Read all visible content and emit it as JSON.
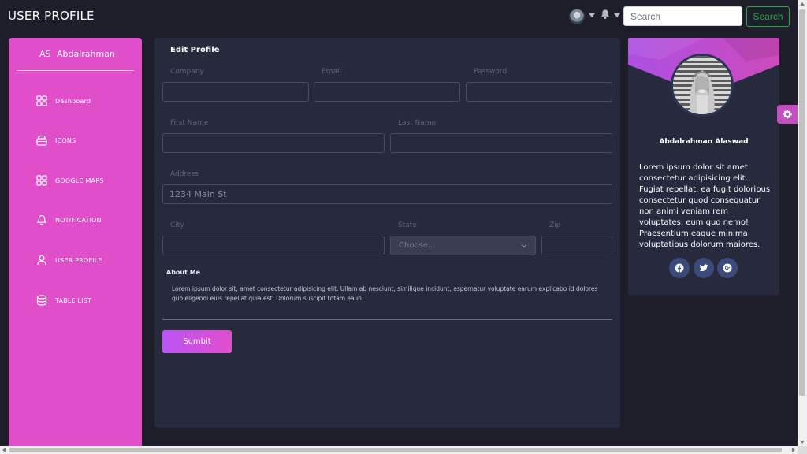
{
  "header": {
    "title": "USER PROFILE",
    "search_placeholder": "Search",
    "search_button": "Search"
  },
  "sidebar": {
    "user_initials": "AS",
    "user_name": "Abdalrahman",
    "items": [
      {
        "label": "Dashboard",
        "icon": "grid-icon"
      },
      {
        "label": "ICONS",
        "icon": "atom-icon"
      },
      {
        "label": "GOOGLE MAPS",
        "icon": "grid-icon"
      },
      {
        "label": "NOTIFICATION",
        "icon": "bell-icon"
      },
      {
        "label": "USER PROFILE",
        "icon": "user-icon"
      },
      {
        "label": "TABLE LIST",
        "icon": "database-icon"
      }
    ]
  },
  "form": {
    "title": "Edit Profile",
    "company_label": "Company",
    "email_label": "Email",
    "password_label": "Password",
    "first_name_label": "First Name",
    "last_name_label": "Last Name",
    "address_label": "Address",
    "address_placeholder": "1234 Main St",
    "city_label": "City",
    "state_label": "State",
    "state_value": "Choose...",
    "zip_label": "Zip",
    "about_label": "About Me",
    "about_text": "Lorem ipsum dolor sit, amet consectetur adipisicing elit. Ullam ab nesciunt, similique incidunt, aspernatur voluptate earum explicabo id dolores quo eligendi eius repellat quia est. Dolorum suscipit totam ea in.",
    "submit_label": "Sumbit"
  },
  "profile_card": {
    "name": "Abdalrahman Alaswad",
    "bio": "Lorem ipsum dolor sit amet consectetur adipisicing elit. Fugiat repellat, ea fugit doloribus consectetur quod consequatur non animi veniam rem voluptates, eum quo nemo! Praesentium eaque minima voluptatibus dolorum maiores.",
    "socials": [
      "facebook-icon",
      "twitter-icon",
      "google-plus-icon"
    ]
  },
  "colors": {
    "accent": "#e14eca",
    "background": "#1e1e2b",
    "card": "#27293d",
    "search_button": "#28a745"
  }
}
